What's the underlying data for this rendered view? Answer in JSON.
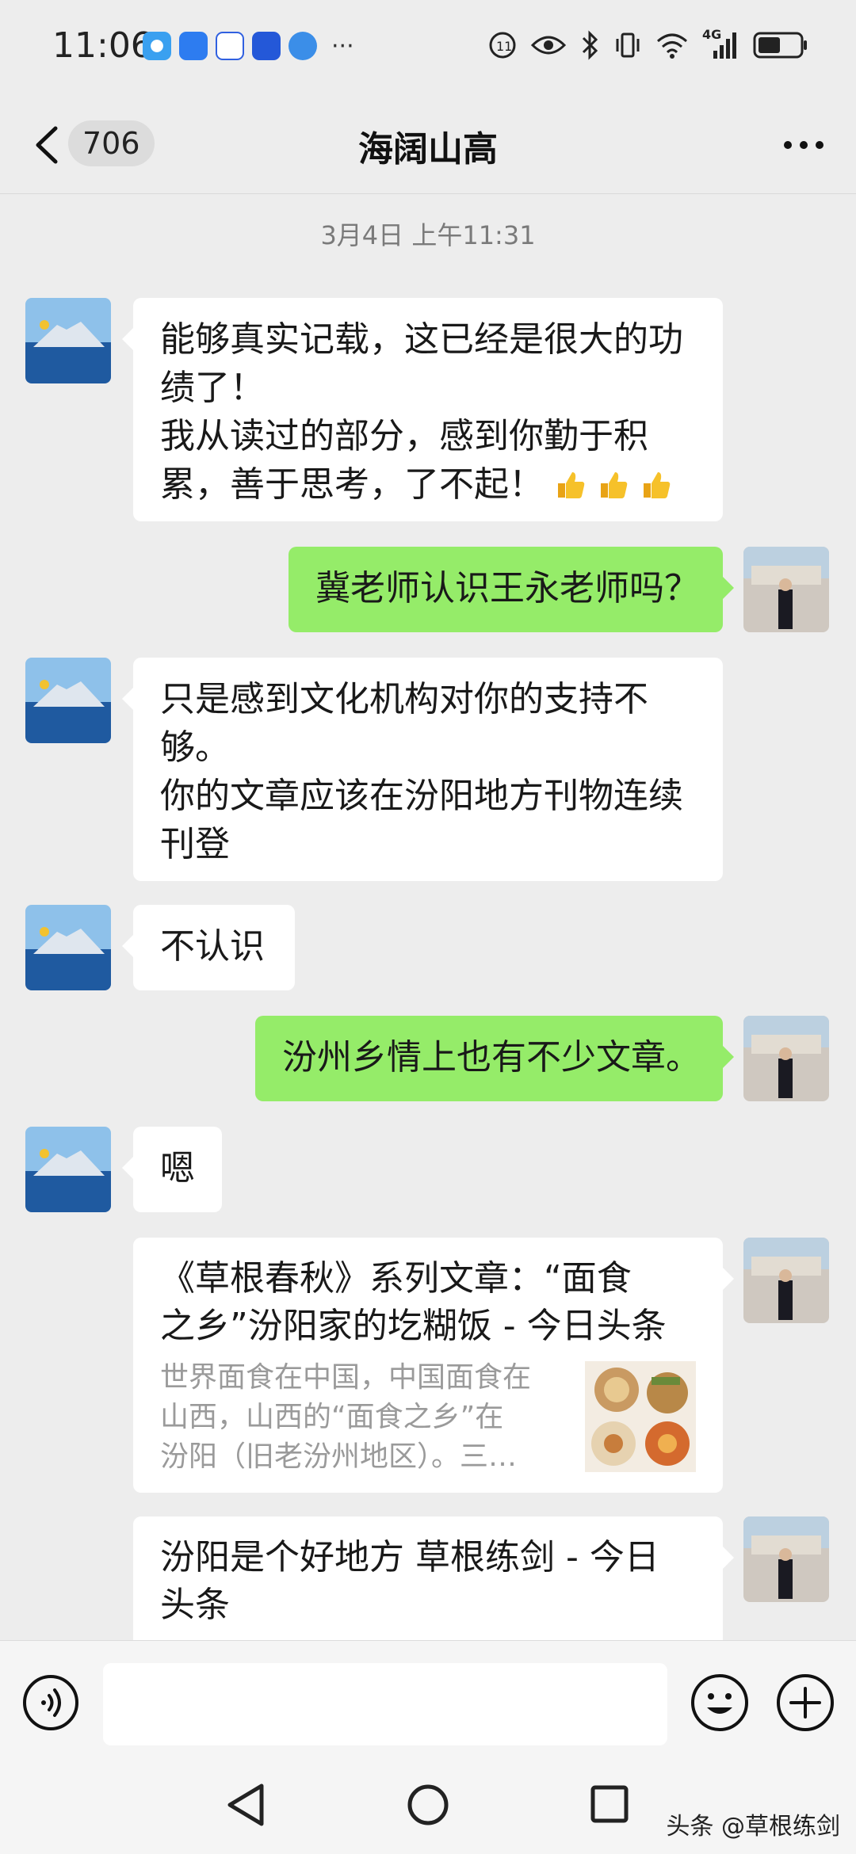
{
  "status_bar": {
    "time": "11:06",
    "network": "4G"
  },
  "header": {
    "unread_count": "706",
    "title": "海阔山高"
  },
  "chat": {
    "timestamp": "3月4日 上午11:31",
    "messages": [
      {
        "side": "left",
        "lines": [
          "能够真实记载，这已经是很大的功",
          "绩了！",
          "我从读过的部分，感到你勤于积",
          "累，善于思考，了不起！"
        ],
        "emoji": "thumbs-up x3"
      },
      {
        "side": "right",
        "lines": [
          "冀老师认识王永老师吗？"
        ]
      },
      {
        "side": "left",
        "lines": [
          "只是感到文化机构对你的支持不",
          "够。",
          "你的文章应该在汾阳地方刊物连续",
          "刊登"
        ]
      },
      {
        "side": "left",
        "lines": [
          "不认识"
        ]
      },
      {
        "side": "right",
        "lines": [
          "汾州乡情上也有不少文章。"
        ]
      },
      {
        "side": "left",
        "lines": [
          "嗯"
        ]
      },
      {
        "side": "right",
        "type": "link-card",
        "title_lines": [
          "《草根春秋》系列文章：“面食",
          "之乡”汾阳家的圪糊饭 - 今日头条"
        ],
        "desc_lines": [
          "世界面食在中国，中国面食在",
          "山西，山西的“面食之乡”在",
          "汾阳（旧老汾州地区）。三…"
        ]
      },
      {
        "side": "right",
        "type": "link-card",
        "title_lines": [
          "汾阳是个好地方 草根练剑 - 今日",
          "头条"
        ]
      }
    ]
  },
  "input_bar": {
    "placeholder": ""
  },
  "watermark": "头条 @草根练剑",
  "colors": {
    "background": "#ededed",
    "my_bubble": "#95ec69",
    "their_bubble": "#ffffff"
  }
}
